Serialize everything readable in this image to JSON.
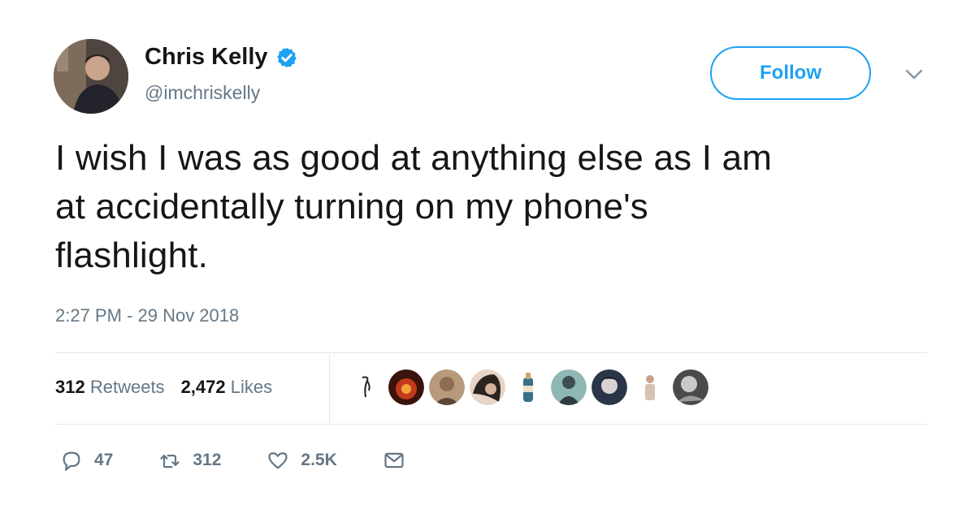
{
  "author": {
    "name": "Chris Kelly",
    "handle": "@imchriskelly",
    "verified": true,
    "verified_color": "#1da1f2"
  },
  "follow_button": {
    "label": "Follow",
    "color": "#1da1f2"
  },
  "tweet": {
    "lines": [
      "I wish I was as good at anything else as I am",
      "at accidentally turning on my phone's",
      "flashlight."
    ],
    "timestamp": "2:27 PM - 29 Nov 2018"
  },
  "stats": {
    "retweets_count": "312",
    "retweets_label": "Retweets",
    "likes_count": "2,472",
    "likes_label": "Likes"
  },
  "liker_avatars": [
    {
      "icon": "sketch-avatar-icon"
    },
    {
      "icon": "red-avatar-icon"
    },
    {
      "icon": "person-avatar-icon"
    },
    {
      "icon": "hair-avatar-icon"
    },
    {
      "icon": "bottle-avatar-icon"
    },
    {
      "icon": "teal-avatar-icon"
    },
    {
      "icon": "bw-avatar-icon"
    },
    {
      "icon": "figure-avatar-icon"
    },
    {
      "icon": "gray-avatar-icon"
    }
  ],
  "actions": {
    "replies": "47",
    "retweets": "312",
    "likes": "2.5K"
  },
  "colors": {
    "text": "#14171a",
    "secondary": "#657786",
    "divider": "#e1e8ed"
  }
}
